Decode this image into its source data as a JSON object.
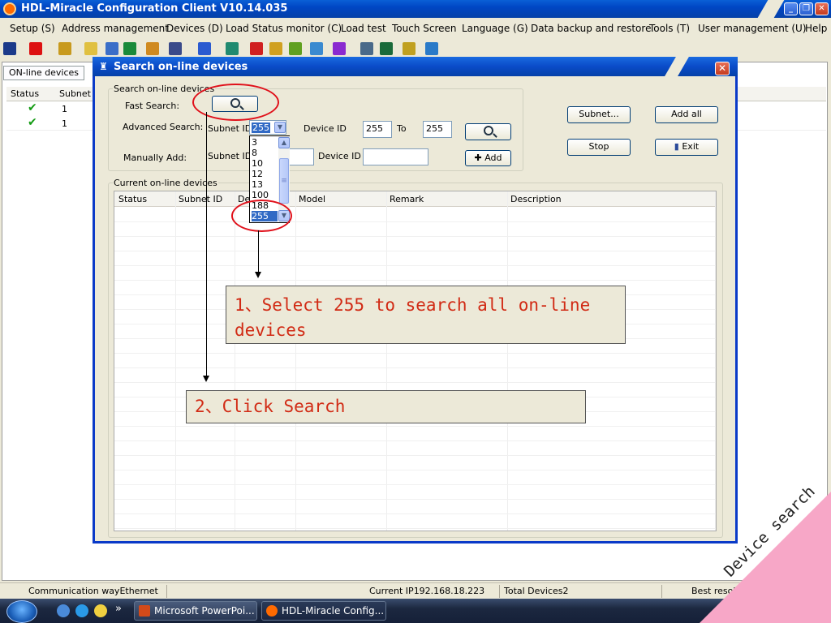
{
  "window": {
    "title": "HDL-Miracle Configuration Client V10.14.035",
    "controls": {
      "minimize": "_",
      "restore": "❐",
      "close": "✕"
    }
  },
  "menu": [
    "Setup (S)",
    "Address management",
    "Devices (D)",
    "Load Status monitor (C)",
    "Load test",
    "Touch Screen",
    "Language (G)",
    "Data backup and restore",
    "Tools (T)",
    "User management (U)",
    "Help ("
  ],
  "toolbar": {
    "icons": [
      "binoculars-icon",
      "delete-x-icon",
      "grid-icon",
      "bulb-icon",
      "user-icon",
      "tree-icon",
      "image-icon",
      "window-icon",
      "clock-icon",
      "network-icon",
      "refresh-icon",
      "folders-icon",
      "chart-icon",
      "monitor-icon",
      "purple-panel-icon",
      "tool-icon",
      "settings-icon",
      "pencil-icon",
      "picture-icon"
    ],
    "colors": [
      "#1b3a8a",
      "#d11",
      "#c89a1e",
      "#e0c040",
      "#3a6ec8",
      "#1a8a3a",
      "#d08a20",
      "#3a4a8a",
      "#2a5ad0",
      "#208a70",
      "#d02020",
      "#d0a020",
      "#60a020",
      "#3a8ad0",
      "#8a2ad0",
      "#4a6a8a",
      "#1a6a3a",
      "#c0a020",
      "#2a7ac8"
    ]
  },
  "background_panel": {
    "tab_label": "ON-line devices",
    "columns": [
      "Status",
      "Subnet I"
    ],
    "rows": [
      {
        "status": "✔",
        "subnet": "1"
      },
      {
        "status": "✔",
        "subnet": "1"
      }
    ]
  },
  "dialog": {
    "title": "Search on-line devices",
    "icon": "binoculars-icon",
    "close": "✕",
    "search_group": {
      "label": "Search on-line devices",
      "fast_search_label": "Fast Search:",
      "advanced_search_label": "Advanced Search:",
      "manually_add_label": "Manually Add:",
      "subnet_id_label": "Subnet ID",
      "device_id_label": "Device ID",
      "to_label": "To",
      "subnet_id_selected": "255",
      "device_id_from": "255",
      "device_id_to": "255",
      "manual_device_id": "",
      "add_label": "Add"
    },
    "subnet_options": [
      "3",
      "8",
      "10",
      "12",
      "13",
      "100",
      "188",
      "255"
    ],
    "buttons": {
      "subnet": "Subnet...",
      "add_all": "Add all",
      "stop": "Stop",
      "exit": "Exit"
    },
    "current_group": {
      "label": "Current on-line devices",
      "columns": [
        "Status",
        "Subnet ID",
        "De",
        "Model",
        "Remark",
        "Description"
      ]
    }
  },
  "annotations": {
    "step1": "1、Select 255 to search all on-line devices",
    "step2": "2、Click Search",
    "corner_label": "Device search"
  },
  "statusbar": {
    "comm": "Communication wayEthernet",
    "ip": "Current IP192.168.18.223",
    "total": "Total Devices2",
    "best": "Best resol"
  },
  "taskbar": {
    "tasks": [
      "Microsoft PowerPoi...",
      "HDL-Miracle Config..."
    ],
    "more": "»"
  }
}
